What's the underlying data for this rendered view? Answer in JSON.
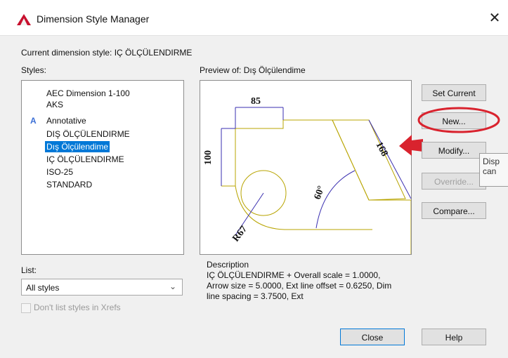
{
  "window": {
    "title": "Dimension Style Manager",
    "close": "✕"
  },
  "current_style_label": "Current dimension style: IÇ ÖLÇÜLENDIRME",
  "styles_label": "Styles:",
  "preview_label": "Preview of: Dış Ölçülendime",
  "styles": [
    "AEC Dimension 1-100",
    "AKS",
    "Annotative",
    "DIŞ ÖLÇÜLENDIRME",
    "Dış Ölçülendime",
    "IÇ ÖLÇÜLENDIRME",
    "ISO-25",
    "STANDARD"
  ],
  "selected_style_index": 4,
  "annotative_icon": "A",
  "list_label": "List:",
  "list_value": "All styles",
  "xrefs_checkbox": "Don't list styles in Xrefs",
  "buttons": {
    "set_current": "Set Current",
    "new": "New...",
    "modify": "Modify...",
    "override": "Override...",
    "compare": "Compare...",
    "close": "Close",
    "help": "Help"
  },
  "description": {
    "label": "Description",
    "text": "IÇ ÖLÇÜLENDIRME + Overall scale = 1.0000, Arrow size = 5.0000, Ext line offset = 0.6250, Dim line spacing = 3.7500, Ext"
  },
  "preview_dims": {
    "top": "85",
    "left": "100",
    "slant": "168",
    "angle": "60°",
    "radius": "R67"
  },
  "tooltip": "Disp can",
  "colors": {
    "accent": "#0078d7",
    "highlight_circle": "#d9232e",
    "arrow": "#d9232e",
    "geometry": "#b8a400",
    "dimension": "#3a2fb0"
  }
}
